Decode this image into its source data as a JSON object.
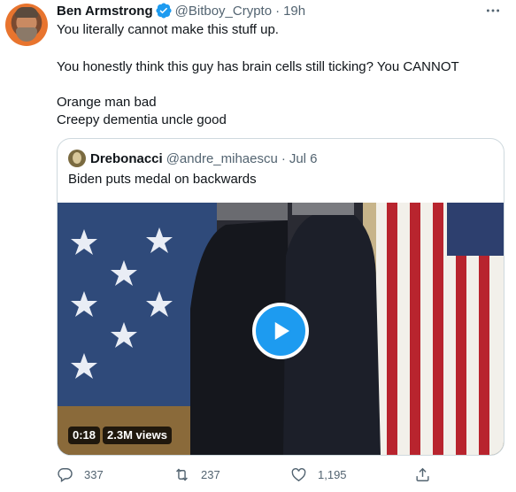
{
  "tweet": {
    "author_name": "Ben Armstrong",
    "handle": "@Bitboy_Crypto",
    "separator": "·",
    "time": "19h",
    "lines": [
      "You literally cannot make this stuff up.",
      "You honestly think this guy has brain cells still ticking? You CANNOT",
      "Orange man bad",
      "Creepy dementia uncle good"
    ]
  },
  "quote": {
    "author_name": "Drebonacci",
    "handle": "@andre_mihaescu",
    "separator": "·",
    "time": "Jul 6",
    "text": "Biden puts medal on backwards",
    "video": {
      "duration": "0:18",
      "views": "2.3M views"
    }
  },
  "actions": {
    "replies": "337",
    "retweets": "237",
    "likes": "1,195"
  },
  "colors": {
    "accent": "#1d9bf0",
    "muted": "#536471",
    "border": "#cfd9de"
  },
  "icons": [
    "verified-badge-icon",
    "more-icon",
    "play-icon",
    "reply-icon",
    "retweet-icon",
    "like-icon",
    "share-icon"
  ]
}
